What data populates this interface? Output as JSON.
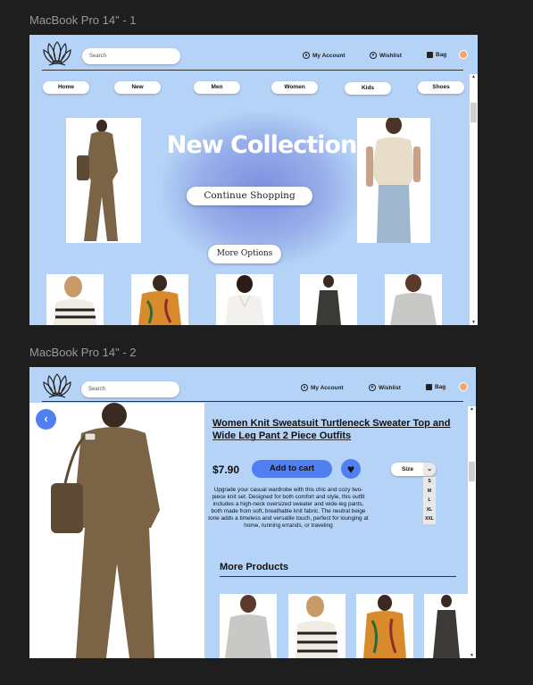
{
  "frames": [
    {
      "label": "MacBook Pro 14\" - 1"
    },
    {
      "label": "MacBook Pro 14\" - 2"
    }
  ],
  "header": {
    "search_placeholder": "Search",
    "account": "My Account",
    "wishlist": "Wishlist",
    "bag": "Bag"
  },
  "nav": [
    "Home",
    "New",
    "Men",
    "Women",
    "Kids",
    "Shoes"
  ],
  "hero": {
    "title": "New Collection",
    "continue": "Continue Shopping",
    "more_options": "More Options"
  },
  "product": {
    "title": "Women Knit Sweatsuit Turtleneck Sweater Top and Wide Leg Pant 2 Piece Outfits",
    "price": "$7.90",
    "add_to_cart": "Add to cart",
    "size_label": "Size",
    "sizes": [
      "S",
      "M",
      "L",
      "XL",
      "XXL"
    ],
    "description": "Upgrade your casual wardrobe with this chic and cozy two-piece knit set. Designed for both comfort and style, this outfit includes a high-neck oversized sweater and wide-leg pants, both made from soft, breathable knit fabric. The neutral beige tone adds a timeless and versatile touch, perfect for lounging at home, running errands, or traveling",
    "more_products": "More Products"
  },
  "colors": {
    "bg": "#b5d3f6",
    "accent": "#4f7ff1",
    "canvas": "#1e1e1e"
  },
  "icons": [
    "logo-icon",
    "user-icon",
    "heart-icon",
    "bag-icon",
    "back-arrow-icon",
    "chevron-down-icon"
  ]
}
